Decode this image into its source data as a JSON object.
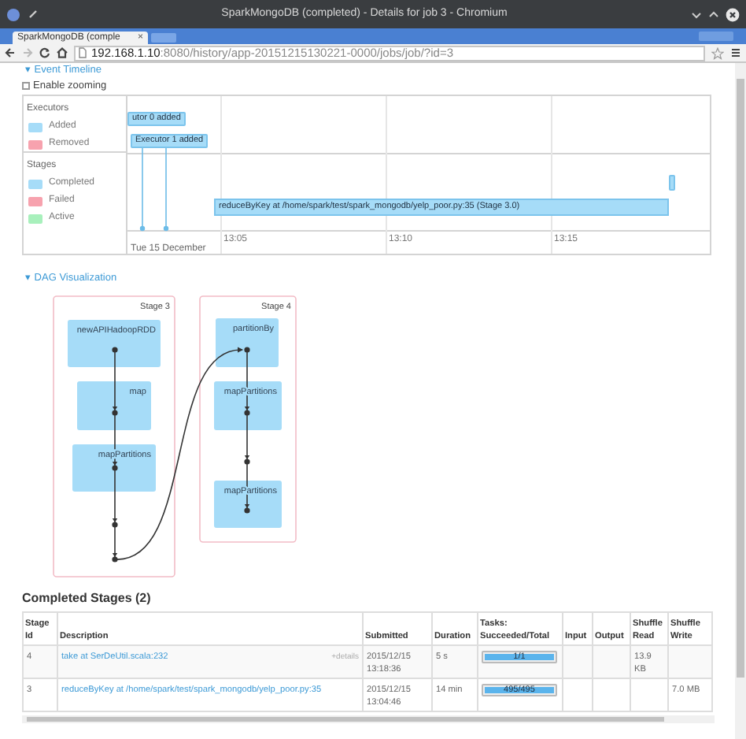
{
  "window": {
    "title": "SparkMongoDB (completed) - Details for job 3 - Chromium"
  },
  "tabs": [
    {
      "label": "SparkMongoDB (comple",
      "selected": true,
      "close": "×"
    }
  ],
  "address_bar": {
    "host": "192.168.1.10",
    "path": ":8080/history/app-20151215130221-0000/jobs/job/?id=3"
  },
  "event_timeline": {
    "toggle": "▾",
    "title": "Event Timeline",
    "enable_zooming": {
      "label": "Enable zooming",
      "checked": false
    },
    "legend": [
      {
        "group": "Executors",
        "items": [
          {
            "label": "Added",
            "color": "#a6dcf8"
          },
          {
            "label": "Removed",
            "color": "#f7a2ae"
          }
        ]
      },
      {
        "group": "Stages",
        "items": [
          {
            "label": "Completed",
            "color": "#a6dcf8"
          },
          {
            "label": "Failed",
            "color": "#f7a2ae"
          },
          {
            "label": "Active",
            "color": "#a8f0bc"
          }
        ]
      }
    ],
    "executor_events": [
      {
        "label": "utor 0 added"
      },
      {
        "label": "Executor 1 added"
      }
    ],
    "stage_bars": [
      {
        "label": "reduceByKey at /home/spark/test/spark_mongodb/yelp_poor.py:35 (Stage 3.0)"
      }
    ],
    "axis": {
      "ticks": [
        "13:05",
        "13:10",
        "13:15"
      ],
      "date": "Tue 15 December"
    }
  },
  "dag": {
    "toggle": "▾",
    "title": "DAG Visualization",
    "stages": [
      {
        "label": "Stage 3",
        "nodes": [
          "newAPIHadoopRDD",
          "map",
          "mapPartitions"
        ]
      },
      {
        "label": "Stage 4",
        "nodes": [
          "partitionBy",
          "mapPartitions",
          "mapPartitions"
        ]
      }
    ]
  },
  "completed_stages": {
    "title": "Completed Stages (2)",
    "columns": [
      "Stage Id",
      "Description",
      "Submitted",
      "Duration",
      "Tasks: Succeeded/Total",
      "Input",
      "Output",
      "Shuffle Read",
      "Shuffle Write"
    ],
    "rows": [
      {
        "stage_id": "4",
        "description": "take at SerDeUtil.scala:232",
        "details": "+details",
        "submitted": "2015/12/15 13:18:36",
        "duration": "5 s",
        "tasks": "1/1",
        "level": 1,
        "shuffle_read": "13.9 KB"
      },
      {
        "stage_id": "3",
        "description": "reduceByKey at /home/spark/test/spark_mongodb/yelp_poor.py:35",
        "submitted": "2015/12/15 13:04:46",
        "duration": "14 min",
        "tasks": "495/495",
        "level": 1,
        "shuffle_write": "7.0 MB"
      }
    ]
  }
}
